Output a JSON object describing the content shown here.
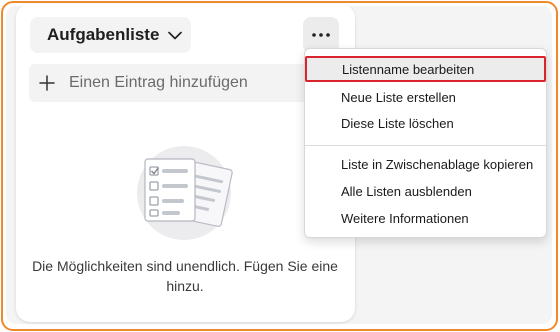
{
  "colors": {
    "frame_border": "#f0892a",
    "highlight_border": "#d9232d",
    "button_bg": "#f3f3f3"
  },
  "list": {
    "title": "Aufgabenliste",
    "title_icon": "chevron-down-icon",
    "more_icon": "more-horizontal-icon"
  },
  "add_entry": {
    "icon": "plus-icon",
    "placeholder": "Einen Eintrag hinzufügen"
  },
  "empty_state": {
    "illustration": "clipboard-checklist-icon",
    "text": "Die Möglichkeiten sind unendlich. Fügen Sie eine hinzu."
  },
  "menu": {
    "items": [
      {
        "label": "Listenname bearbeiten",
        "highlighted": true
      },
      {
        "label": "Neue Liste erstellen"
      },
      {
        "label": "Diese Liste löschen"
      },
      {
        "label": "Liste in Zwischenablage kopieren"
      },
      {
        "label": "Alle Listen ausblenden"
      },
      {
        "label": "Weitere Informationen"
      }
    ]
  }
}
